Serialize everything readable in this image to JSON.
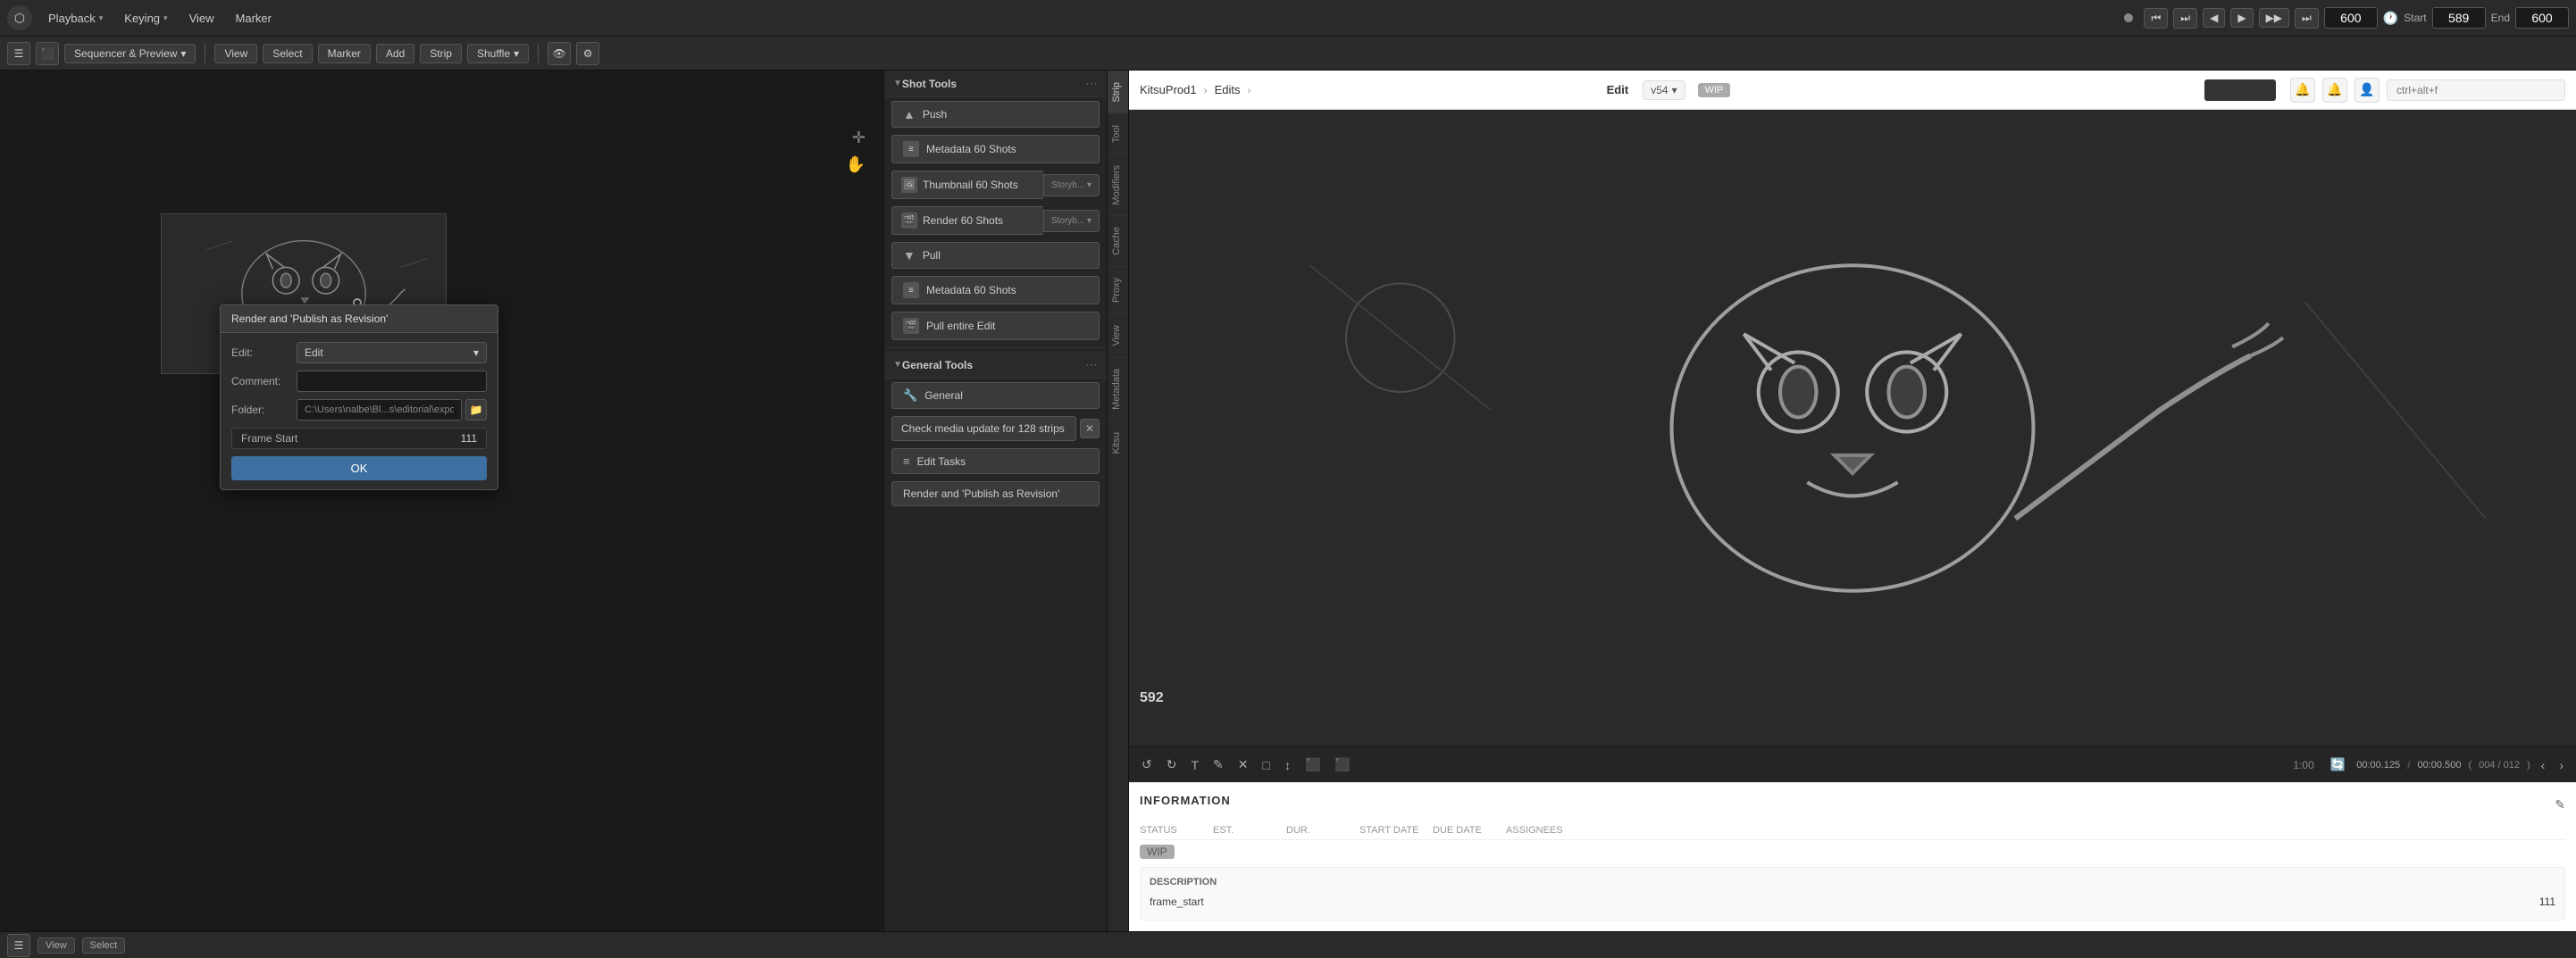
{
  "topbar": {
    "logo": "▶",
    "menus": [
      {
        "label": "Playback",
        "has_arrow": true
      },
      {
        "label": "Keying",
        "has_arrow": true
      },
      {
        "label": "View"
      },
      {
        "label": "Marker"
      }
    ],
    "record_active": false,
    "transport": {
      "skip_start": "⏮",
      "prev_keyframe": "⏭",
      "step_back": "◀",
      "play_pause": "▶",
      "step_forward": "▶▶",
      "skip_end": "⏭"
    },
    "frame_current": "600",
    "frame_start_label": "Start",
    "frame_start_val": "589",
    "frame_end_label": "End",
    "frame_end_val": "600",
    "clock_icon": "🕐"
  },
  "secondary_toolbar": {
    "app_icon": "☰",
    "preview_icon": "⬛",
    "seq_preview_label": "Sequencer & Preview",
    "seq_preview_arrow": "▾",
    "view_label": "View",
    "select_label": "Select",
    "marker_label": "Marker",
    "add_label": "Add",
    "strip_label": "Strip",
    "shuffle_label": "Shuffle",
    "shuffle_arrow": "▾",
    "view_icon": "👁",
    "settings_icon": "⚙"
  },
  "viewport_icons": {
    "crosshair": "✛",
    "hand": "✋"
  },
  "dialog": {
    "title": "Render and 'Publish as Revision'",
    "edit_label": "Edit:",
    "edit_value": "Edit",
    "comment_label": "Comment:",
    "comment_placeholder": "",
    "folder_label": "Folder:",
    "folder_value": "C:\\Users\\nalbe\\Bl...s\\editorial\\export",
    "frame_start_label": "Frame Start",
    "frame_start_value": "111",
    "ok_label": "OK"
  },
  "shot_tools": {
    "section_title": "Shot Tools",
    "push_label": "Push",
    "push_icon": "▲",
    "metadata_label": "Metadata 60 Shots",
    "metadata_icon": "≡",
    "thumbnail_label": "Thumbnail 60 Shots",
    "thumbnail_icon": "🖼",
    "thumbnail_dropdown": "Storyb...",
    "render_label": "Render 60 Shots",
    "render_icon": "🎬",
    "render_dropdown": "Storyb...",
    "pull_label": "Pull",
    "pull_icon": "▼",
    "pull_metadata_label": "Metadata 60 Shots",
    "pull_metadata_icon": "≡",
    "pull_entire_label": "Pull entire Edit",
    "pull_entire_icon": "🎬"
  },
  "general_tools": {
    "section_title": "General Tools",
    "general_label": "General",
    "wrench_icon": "🔧",
    "media_check_label": "Check media update for 128 strips",
    "media_check_close": "✕",
    "edit_tasks_label": "Edit Tasks",
    "tasks_icon": "≡",
    "render_publish_label": "Render and 'Publish as Revision'",
    "render_publish_icon": "▶"
  },
  "side_tabs": [
    {
      "label": "Strip"
    },
    {
      "label": "Tool"
    },
    {
      "label": "Modifiers"
    },
    {
      "label": "Cache"
    },
    {
      "label": "Proxy"
    },
    {
      "label": "View"
    },
    {
      "label": "Metadata"
    },
    {
      "label": "Kitsu"
    }
  ],
  "kitsu": {
    "breadcrumb": {
      "project": "KitsuProd1",
      "section": "Edits",
      "item": "Edit",
      "version": "v54",
      "status": "WIP"
    },
    "search_placeholder": "ctrl+alt+f",
    "icons": [
      "🔔",
      "🔔",
      "👤"
    ],
    "preview_frame": "592",
    "timecode_current": "00:00.125",
    "timecode_total": "00:00.500",
    "frame_counter": "004 / 012",
    "edit_tools": [
      "↺",
      "↻",
      "T",
      "✎",
      "✕",
      "□",
      "↕",
      "⬛",
      "⬛"
    ],
    "info_section": {
      "title": "INFORMATION",
      "edit_icon": "✎",
      "table_headers": [
        "STATUS",
        "EST.",
        "DUR.",
        "START DATE",
        "DUE DATE",
        "ASSIGNEES"
      ],
      "status_badge": "WIP",
      "description": {
        "title": "Description",
        "frame_start_label": "frame_start",
        "frame_start_value": "111"
      }
    }
  },
  "bottom_statusbar": {
    "icon": "☰",
    "view_label": "View",
    "select_label": "Select"
  }
}
